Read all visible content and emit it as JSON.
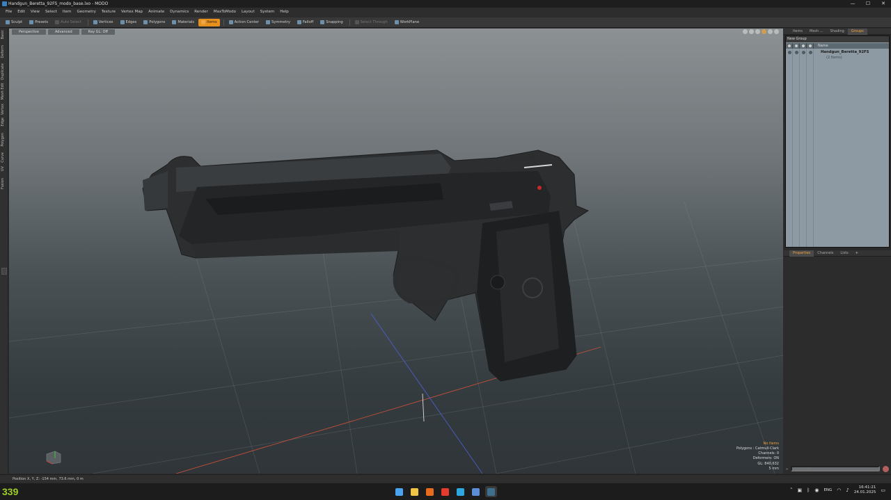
{
  "window": {
    "title": "Handgun_Beretta_92FS_modo_base.lxo - MODO",
    "controls": [
      "—",
      "☐",
      "✕"
    ]
  },
  "menu": [
    "File",
    "Edit",
    "View",
    "Select",
    "Item",
    "Geometry",
    "Texture",
    "Vertex Map",
    "Animate",
    "Dynamics",
    "Render",
    "MaxToModo",
    "Layout",
    "System",
    "Help"
  ],
  "toolbar": [
    {
      "label": "Sculpt",
      "state": "normal"
    },
    {
      "label": "Presets",
      "state": "normal"
    },
    {
      "label": "Auto Select",
      "state": "dim"
    },
    {
      "label": "Vertices",
      "state": "normal"
    },
    {
      "label": "Edges",
      "state": "normal"
    },
    {
      "label": "Polygons",
      "state": "normal"
    },
    {
      "label": "Materials",
      "state": "normal"
    },
    {
      "label": "Items",
      "state": "active"
    },
    {
      "label": "Action Center",
      "state": "normal"
    },
    {
      "label": "Symmetry",
      "state": "normal"
    },
    {
      "label": "Falloff",
      "state": "normal"
    },
    {
      "label": "Snapping",
      "state": "normal"
    },
    {
      "label": "Select Through",
      "state": "dim"
    },
    {
      "label": "WorkPlane",
      "state": "normal"
    }
  ],
  "left_tabs": [
    "Basic",
    "Deform",
    "Duplicate",
    "Mesh Edit",
    "Vertex",
    "Edge",
    "Polygon",
    "Curve",
    "UV",
    "Fusion"
  ],
  "viewport": {
    "buttons": [
      "Perspective",
      "Advanced",
      "Ray GL: Off"
    ],
    "info": {
      "status": "No Items",
      "lines": [
        "Polygons : Catmull-Clark",
        "Channels: 0",
        "Deformers: ON",
        "GL: 840,632",
        "5 mm"
      ]
    }
  },
  "groups_panel": {
    "tabs": [
      "Items",
      "Mesh ...",
      "Shading",
      "Groups"
    ],
    "active_tab": "Groups",
    "new_group": "New Group",
    "name_header": "Name",
    "rows": [
      {
        "label": "Handgun_Beretta_92FS",
        "bold": true
      },
      {
        "label": "(2 Items)",
        "bold": false
      }
    ]
  },
  "properties_panel": {
    "tabs": [
      "Properties",
      "Channels",
      "Lists",
      "+"
    ],
    "active_tab": "Properties"
  },
  "command": {
    "placeholder": "Command"
  },
  "statusbar": {
    "text": "Position X, Y, Z:   -154 mm, 73.6 mm, 0 m"
  },
  "taskbar": {
    "fps": "339",
    "apps": [
      {
        "name": "start-icon",
        "color": "#4aa3f0"
      },
      {
        "name": "file-explorer-icon",
        "color": "#f1c445"
      },
      {
        "name": "browser-icon",
        "color": "#e86a1c"
      },
      {
        "name": "yandex-icon",
        "color": "#e33b2e"
      },
      {
        "name": "telegram-icon",
        "color": "#2da7e0"
      },
      {
        "name": "app-3-icon",
        "color": "#5a8fd8"
      },
      {
        "name": "modo-icon",
        "color": "#3f6f8f"
      }
    ],
    "lang": "ENG",
    "time": "16:41:21",
    "date": "24.01.2025"
  }
}
